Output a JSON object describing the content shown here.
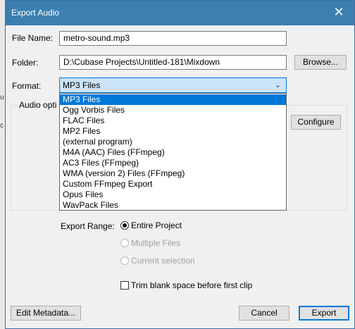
{
  "dialog": {
    "title": "Export Audio",
    "close_glyph": "✕"
  },
  "fields": {
    "file_name_label": "File Name:",
    "file_name_value": "metro-sound.mp3",
    "folder_label": "Folder:",
    "folder_value": "D:\\Cubase Projects\\Untitled-181\\Mixdown",
    "browse_label": "Browse...",
    "format_label": "Format:",
    "format_selected": "MP3 Files"
  },
  "audio_options": {
    "legend": "Audio opti",
    "configure_label": "Configure"
  },
  "format_options": [
    "MP3 Files",
    "Ogg Vorbis Files",
    "FLAC Files",
    "MP2 Files",
    "(external program)",
    "M4A (AAC) Files (FFmpeg)",
    "AC3 Files (FFmpeg)",
    "WMA (version 2) Files (FFmpeg)",
    "Custom FFmpeg Export",
    "Opus Files",
    "WavPack Files"
  ],
  "export_range": {
    "label": "Export Range:",
    "entire_project": "Entire Project",
    "multiple_files": "Multiple Files",
    "current_selection": "Current selection"
  },
  "trim_label": "Trim blank space before first clip",
  "footer": {
    "edit_metadata": "Edit Metadata...",
    "cancel": "Cancel",
    "export": "Export"
  },
  "icons": {
    "chevron": "chevron-down-icon",
    "close": "close-icon"
  },
  "colors": {
    "titlebar": "#3c7fb1",
    "selection": "#0078d7",
    "select_bg": "#cce4f7"
  }
}
